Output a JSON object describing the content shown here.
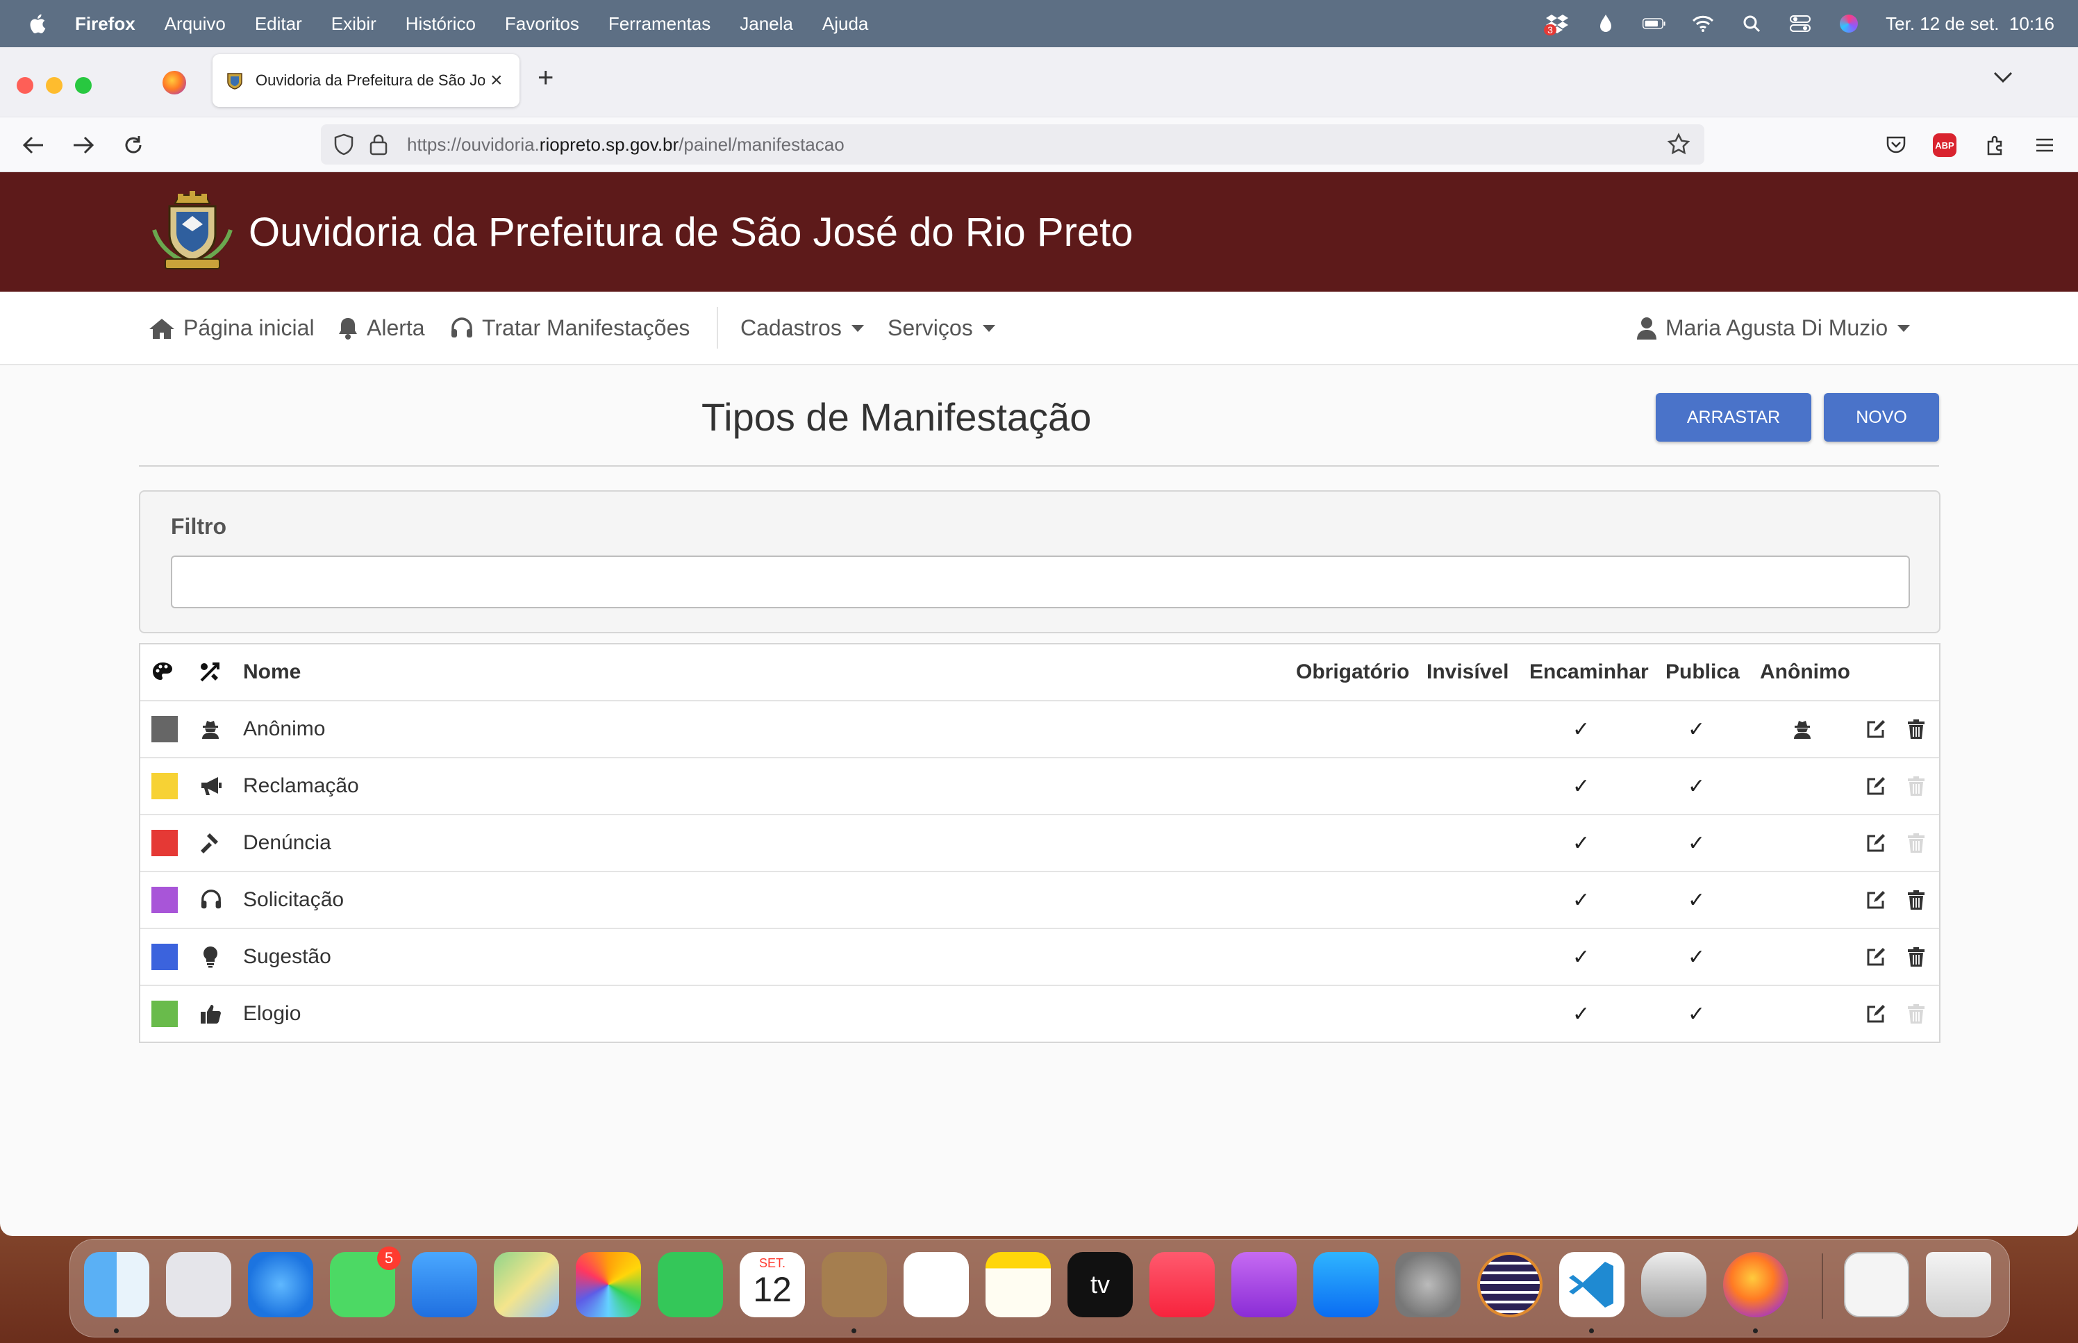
{
  "menubar": {
    "app": "Firefox",
    "items": [
      "Arquivo",
      "Editar",
      "Exibir",
      "Histórico",
      "Favoritos",
      "Ferramentas",
      "Janela",
      "Ajuda"
    ],
    "clock": "Ter. 12 de set.  10:16",
    "dropbox_badge": "3"
  },
  "browser": {
    "tab_title": "Ouvidoria da Prefeitura de São José do Rio Preto",
    "url_prefix": "https://ouvidoria.",
    "url_domain": "riopreto.sp.gov.br",
    "url_path": "/painel/manifestacao",
    "abp_label": "ABP"
  },
  "site": {
    "title": "Ouvidoria da Prefeitura de São José do Rio Preto",
    "nav": {
      "home": "Página inicial",
      "alert": "Alerta",
      "treat": "Tratar Manifestações",
      "cadastros": "Cadastros",
      "servicos": "Serviços",
      "user": "Maria Agusta Di Muzio"
    }
  },
  "page": {
    "title": "Tipos de Manifestação",
    "drag_button": "ARRASTAR",
    "new_button": "NOVO",
    "filter_label": "Filtro",
    "filter_value": ""
  },
  "table": {
    "headers": {
      "name": "Nome",
      "required": "Obrigatório",
      "invisible": "Invisível",
      "forward": "Encaminhar",
      "publish": "Publica",
      "anonymous": "Anônimo"
    },
    "check_glyph": "✓",
    "rows": [
      {
        "name": "Anônimo",
        "color": "#666666",
        "icon": "user-secret-icon",
        "forward": true,
        "publish": true,
        "anonymous": true,
        "delete_enabled": true
      },
      {
        "name": "Reclamação",
        "color": "#f7d234",
        "icon": "bullhorn-icon",
        "forward": true,
        "publish": true,
        "anonymous": false,
        "delete_enabled": false
      },
      {
        "name": "Denúncia",
        "color": "#e53935",
        "icon": "gavel-icon",
        "forward": true,
        "publish": true,
        "anonymous": false,
        "delete_enabled": false
      },
      {
        "name": "Solicitação",
        "color": "#a855d8",
        "icon": "headset-icon",
        "forward": true,
        "publish": true,
        "anonymous": false,
        "delete_enabled": true
      },
      {
        "name": "Sugestão",
        "color": "#3b63dd",
        "icon": "lightbulb-icon",
        "forward": true,
        "publish": true,
        "anonymous": false,
        "delete_enabled": true
      },
      {
        "name": "Elogio",
        "color": "#69bb4b",
        "icon": "thumbs-up-icon",
        "forward": true,
        "publish": true,
        "anonymous": false,
        "delete_enabled": false
      }
    ]
  },
  "dock": {
    "messages_badge": "5",
    "calendar_month": "SET.",
    "calendar_day": "12",
    "tv_label": "tv"
  }
}
